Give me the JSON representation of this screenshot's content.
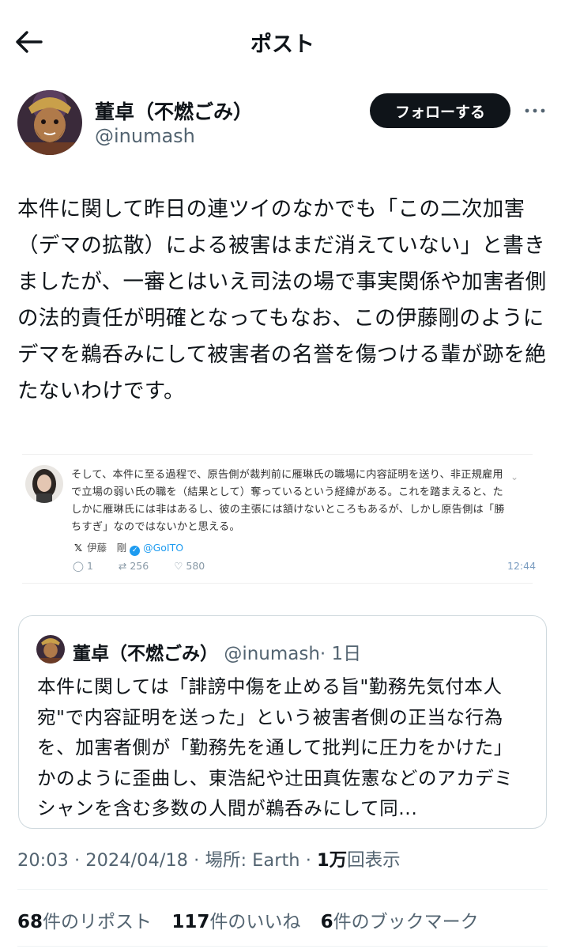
{
  "header": {
    "title": "ポスト",
    "back_icon": "arrow-left-icon"
  },
  "author": {
    "display_name": "董卓（不燃ごみ）",
    "handle": "@inumash",
    "follow_label": "フォローする",
    "more_icon": "more-horizontal-icon"
  },
  "post": {
    "text": "本件に関して昨日の連ツイのなかでも「この二次加害（デマの拡散）による被害はまだ消えていない」と書きましたが、一審とはいえ司法の場で事実関係や加害者側の法的責任が明確となってもなお、この伊藤剛のようにデマを鵜呑みにして被害者の名誉を傷つける輩が跡を絶たないわけです。"
  },
  "embedded_screenshot": {
    "text": "そして、本件に至る過程で、原告側が裁判前に雁琳氏の職場に内容証明を送り、非正規雇用で立場の弱い氏の職を（結果として）奪っているという経緯がある。これを踏まえると、たしかに雁琳氏には非はあるし、彼の主張には頷けないところもあるが、しかし原告側は「勝ちすぎ」なのではないかと思える。",
    "source_name": "伊藤　剛",
    "source_handle": "@GoITO",
    "replies": "1",
    "reposts": "256",
    "likes": "580",
    "time": "12:44"
  },
  "quote": {
    "display_name": "董卓（不燃ごみ）",
    "handle": "@inumash",
    "age": "· 1日",
    "text": "本件に関しては「誹謗中傷を止める旨\"勤務先気付本人宛\"で内容証明を送った」という被害者側の正当な行為を、加害者側が「勤務先を通して批判に圧力をかけた」かのように歪曲し、東浩紀や辻田真佐憲などのアカデミシャンを含む多数の人間が鵜呑みにして同..."
  },
  "meta": {
    "timestamp": "20:03 · 2024/04/18",
    "location_label": "場所: Earth",
    "views_count": "1万",
    "views_label": "回表示"
  },
  "stats": {
    "reposts_count": "68",
    "reposts_label": "件のリポスト",
    "likes_count": "117",
    "likes_label": "件のいいね",
    "bookmarks_count": "6",
    "bookmarks_label": "件のブックマーク"
  },
  "colors": {
    "accent": "#1d9bf0",
    "text": "#0f1419",
    "secondary": "#536471",
    "border": "#cfd9de"
  }
}
